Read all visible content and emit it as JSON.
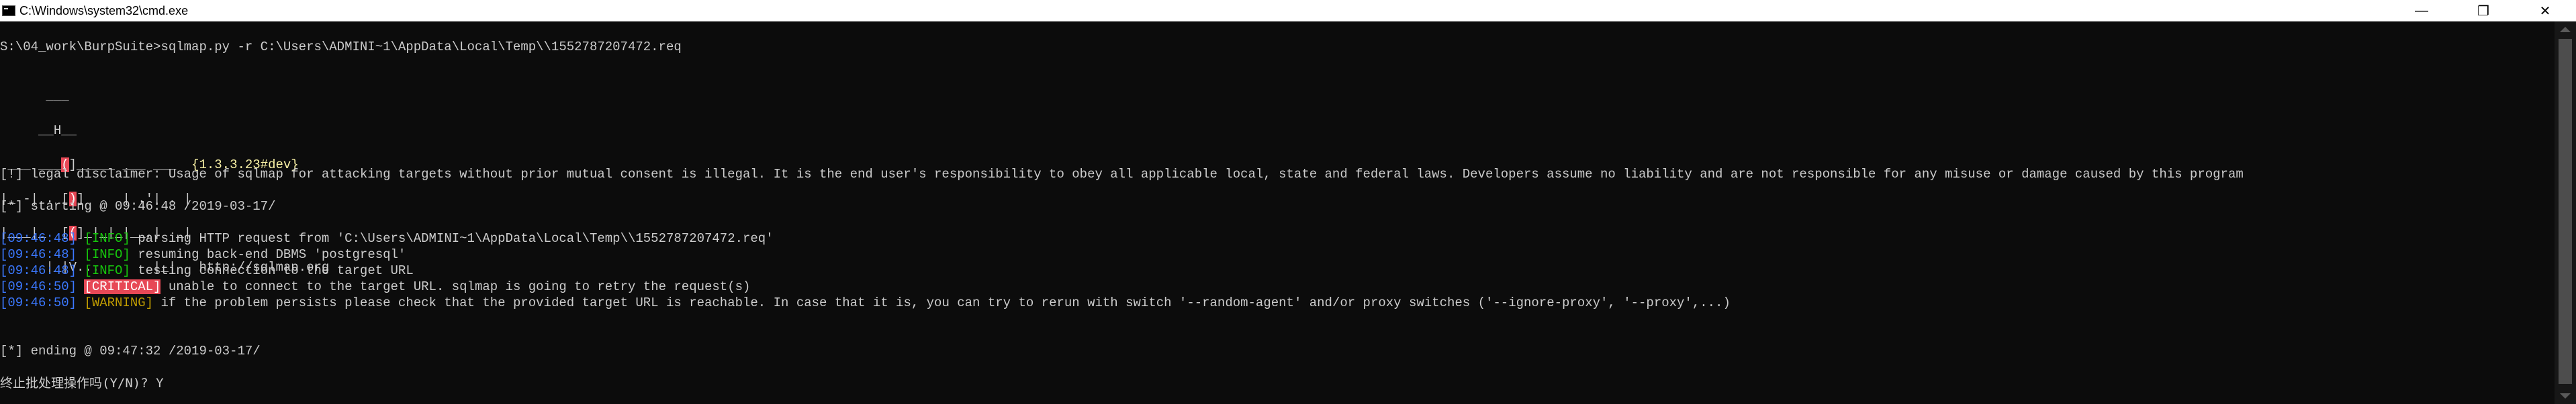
{
  "window": {
    "title": "C:\\Windows\\system32\\cmd.exe",
    "minimize_glyph": "—",
    "maximize_glyph": "❐",
    "close_glyph": "✕"
  },
  "terminal": {
    "command_line": "S:\\04_work\\BurpSuite>sqlmap.py -r C:\\Users\\ADMINI~1\\AppData\\Local\\Temp\\\\1552787207472.req",
    "banner": {
      "row1": "      ___",
      "row2a": "     __H__",
      "row3a": " ___ ___",
      "row3b": "(",
      "row3c": "]_____ ___ ___  ",
      "version": "{1.3.3.23#dev}",
      "row4a": "|_ -| . [",
      "row4b": ")",
      "row4c": "]     | .'| . |",
      "row5a": "|___|_  [",
      "row5b": "(",
      "row5c": "]_|_|_|__,|  _|",
      "row6a": "      |_|V...       |_|   ",
      "url": "http://sqlmap.org"
    },
    "disclaimer": "[!] legal disclaimer: Usage of sqlmap for attacking targets without prior mutual consent is illegal. It is the end user's responsibility to obey all applicable local, state and federal laws. Developers assume no liability and are not responsible for any misuse or damage caused by this program",
    "starting": "[*] starting @ 09:46:48 /2019-03-17/",
    "log": [
      {
        "time": "[09:46:48]",
        "level": "[INFO]",
        "msg": " parsing HTTP request from 'C:\\Users\\ADMINI~1\\AppData\\Local\\Temp\\\\1552787207472.req'"
      },
      {
        "time": "[09:46:48]",
        "level": "[INFO]",
        "msg": " resuming back-end DBMS 'postgresql'"
      },
      {
        "time": "[09:46:48]",
        "level": "[INFO]",
        "msg": " testing connection to the target URL"
      },
      {
        "time": "[09:46:50]",
        "level": "[CRITICAL]",
        "msg": " unable to connect to the target URL. sqlmap is going to retry the request(s)"
      },
      {
        "time": "[09:46:50]",
        "level": "[WARNING]",
        "msg": " if the problem persists please check that the provided target URL is reachable. In case that it is, you can try to rerun with switch '--random-agent' and/or proxy switches ('--ignore-proxy', '--proxy',...)"
      }
    ],
    "ending": "[*] ending @ 09:47:32 /2019-03-17/",
    "prompt": "终止批处理操作吗(Y/N)? Y"
  },
  "colors": {
    "background": "#0c0c0c",
    "text": "#cccccc",
    "timestamp": "#3b78ff",
    "info": "#16c60c",
    "warning": "#c19c00",
    "critical_bg": "#e74856"
  }
}
